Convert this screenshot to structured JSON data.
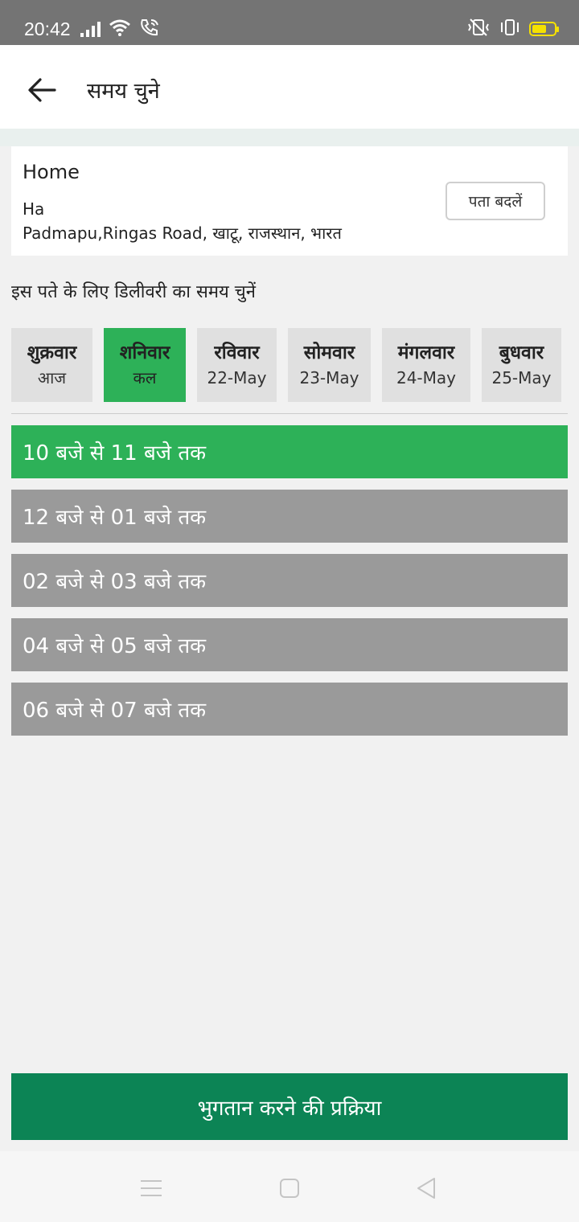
{
  "status_bar": {
    "time": "20:42",
    "icons_left": [
      "signal-icon",
      "wifi-icon",
      "wifi-calling-icon"
    ],
    "icons_right": [
      "vibrate-off-icon",
      "vibrate-icon",
      "battery-icon"
    ],
    "battery_color": "#f5e100"
  },
  "header": {
    "title": "समय चुने",
    "back_icon": "back-arrow-icon"
  },
  "address": {
    "label": "Home",
    "line1": "Ha",
    "line2": "Padmapu,Ringas Road, खाटू, राजस्थान, भारत",
    "change_button": "पता बदलें"
  },
  "prompt": "इस पते के लिए डिलीवरी का समय चुनें",
  "days": [
    {
      "name": "शुक्रवार",
      "date": "आज",
      "selected": false
    },
    {
      "name": "शनिवार",
      "date": "कल",
      "selected": true
    },
    {
      "name": "रविवार",
      "date": "22-May",
      "selected": false
    },
    {
      "name": "सोमवार",
      "date": "23-May",
      "selected": false
    },
    {
      "name": "मंगलवार",
      "date": "24-May",
      "selected": false
    },
    {
      "name": "बुधवार",
      "date": "25-May",
      "selected": false
    }
  ],
  "slots": [
    {
      "label": "10 बजे से 11 बजे तक",
      "selected": true
    },
    {
      "label": "12 बजे से 01 बजे तक",
      "selected": false
    },
    {
      "label": "02 बजे से 03 बजे तक",
      "selected": false
    },
    {
      "label": "04 बजे से 05 बजे तक",
      "selected": false
    },
    {
      "label": "06 बजे से 07 बजे तक",
      "selected": false
    }
  ],
  "proceed_button": "भुगतान करने की प्रक्रिया",
  "colors": {
    "selected_green": "#2db158",
    "unselected_slot": "#9a9a9a",
    "unselected_day": "#e0e0e0",
    "proceed_green": "#0c8455"
  },
  "nav_bar": [
    "menu-icon",
    "home-icon",
    "back-icon"
  ]
}
